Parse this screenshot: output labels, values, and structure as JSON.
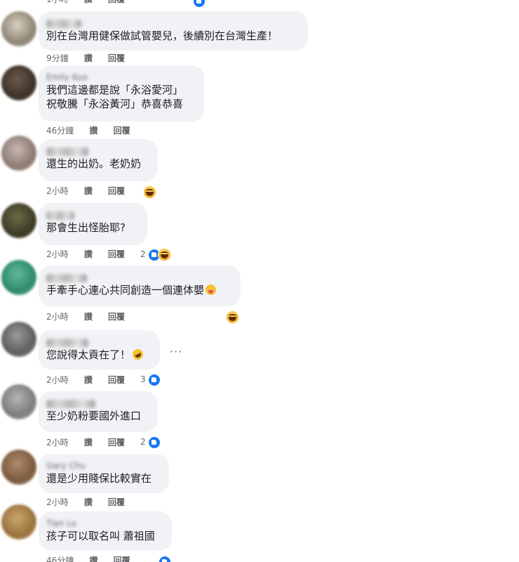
{
  "top_partial": {
    "time": "1小時",
    "like_label": "讚",
    "reply_label": "回覆"
  },
  "comments": [
    {
      "name": "",
      "text_lines": [
        "別在台灣用健保做試管嬰兒，後續別在台灣生產！"
      ],
      "time": "9分鐘",
      "like_label": "讚",
      "reply_label": "回覆",
      "reaction_count": ""
    },
    {
      "name": "Emily Kuo",
      "text_lines": [
        "我們這邊都是說「永浴愛河」",
        "祝敬騰「永浴黃河」恭喜恭喜"
      ],
      "time": "46分鐘",
      "like_label": "讚",
      "reply_label": "回覆",
      "reaction_count": ""
    },
    {
      "name": "",
      "text_lines": [
        "還生的出奶。老奶奶"
      ],
      "time": "2小時",
      "like_label": "讚",
      "reply_label": "回覆",
      "reaction_count": ""
    },
    {
      "name": "",
      "text_lines": [
        "那會生出怪胎耶?"
      ],
      "time": "2小時",
      "like_label": "讚",
      "reply_label": "回覆",
      "reaction_count": "2"
    },
    {
      "name": "",
      "text_lines": [
        "手牽手心連心共同創造一個連体嬰"
      ],
      "time": "2小時",
      "like_label": "讚",
      "reply_label": "回覆",
      "reaction_count": ""
    },
    {
      "name": "",
      "text_lines": [
        "您說得太貢在了！"
      ],
      "time": "2小時",
      "like_label": "讚",
      "reply_label": "回覆",
      "reaction_count": "3"
    },
    {
      "name": "",
      "text_lines": [
        "至少奶粉要國外進口"
      ],
      "time": "2小時",
      "like_label": "讚",
      "reply_label": "回覆",
      "reaction_count": "2"
    },
    {
      "name": "Gary Chu",
      "text_lines": [
        "還是少用賤保比較實在"
      ],
      "time": "2小時",
      "like_label": "讚",
      "reply_label": "回覆",
      "reaction_count": ""
    },
    {
      "name": "Tian Lo",
      "text_lines": [
        "孩子可以取名叫 蕭祖國"
      ],
      "time": "46分鐘",
      "like_label": "讚",
      "reply_label": "回覆",
      "reaction_count": ""
    }
  ],
  "more_options": "···",
  "colors": {
    "bubble": "#f0f2f5",
    "meta": "#65676b",
    "like_blue": "#1877f2",
    "haha_yellow": "#f7b125"
  },
  "icons": [
    "like-icon",
    "haha-icon",
    "tongue-out-emoji",
    "rofl-emoji",
    "more-options-icon"
  ]
}
